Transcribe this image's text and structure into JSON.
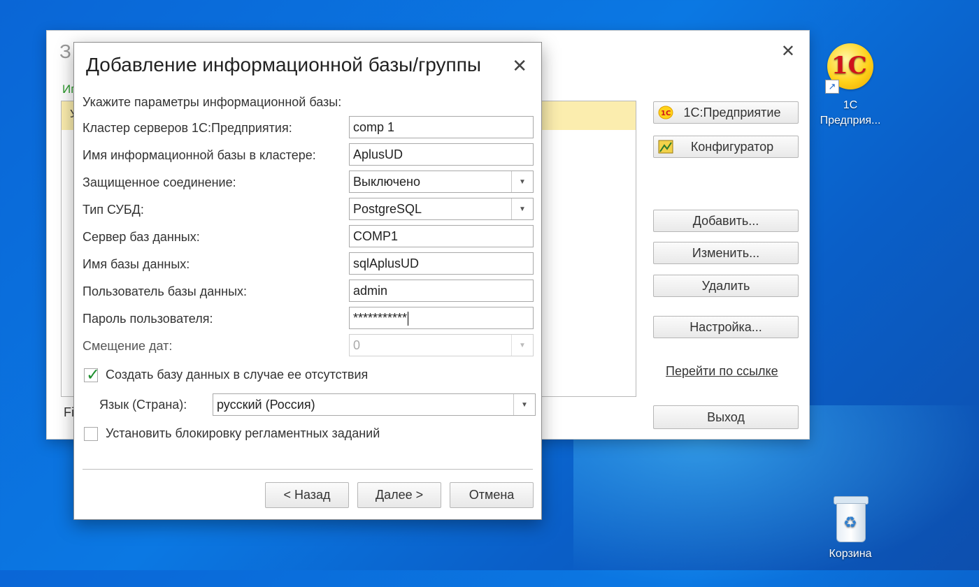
{
  "launcher": {
    "title_fragment": "З",
    "list_label_fragment": "Иг",
    "selected_row_fragment": "У",
    "path_fragment": "Fi",
    "buttons": {
      "enterprise": "1С:Предприятие",
      "configurator": "Конфигуратор",
      "add": "Добавить...",
      "edit": "Изменить...",
      "delete": "Удалить",
      "settings": "Настройка...",
      "exit": "Выход"
    },
    "link": "Перейти по ссылке"
  },
  "desktop": {
    "icon_1c": {
      "label_line1": "1С",
      "label_line2": "Предприя..."
    },
    "recycle_bin": {
      "label": "Корзина"
    }
  },
  "dialog": {
    "title": "Добавление информационной базы/группы",
    "hint": "Укажите параметры информационной базы:",
    "fields": {
      "cluster_label": "Кластер серверов 1С:Предприятия:",
      "cluster_value": "comp 1",
      "ib_name_label": "Имя информационной базы в кластере:",
      "ib_name_value": "AplusUD",
      "secure_label": "Защищенное соединение:",
      "secure_value": "Выключено",
      "dbms_label": "Тип СУБД:",
      "dbms_value": "PostgreSQL",
      "db_server_label": "Сервер баз данных:",
      "db_server_value": "COMP1",
      "db_name_label": "Имя базы данных:",
      "db_name_value": "sqlAplusUD",
      "db_user_label": "Пользователь базы данных:",
      "db_user_value": "admin",
      "password_label": "Пароль пользователя:",
      "password_value": "***********",
      "date_offset_label": "Смещение дат:",
      "date_offset_value": "0"
    },
    "create_db_checkbox": {
      "label": "Создать базу данных в случае ее отсутствия",
      "checked": true
    },
    "language_label": "Язык (Страна):",
    "language_value": "русский (Россия)",
    "lock_jobs_checkbox": {
      "label": "Установить блокировку регламентных заданий",
      "checked": false
    },
    "buttons": {
      "back": "< Назад",
      "next": "Далее >",
      "cancel": "Отмена"
    }
  }
}
